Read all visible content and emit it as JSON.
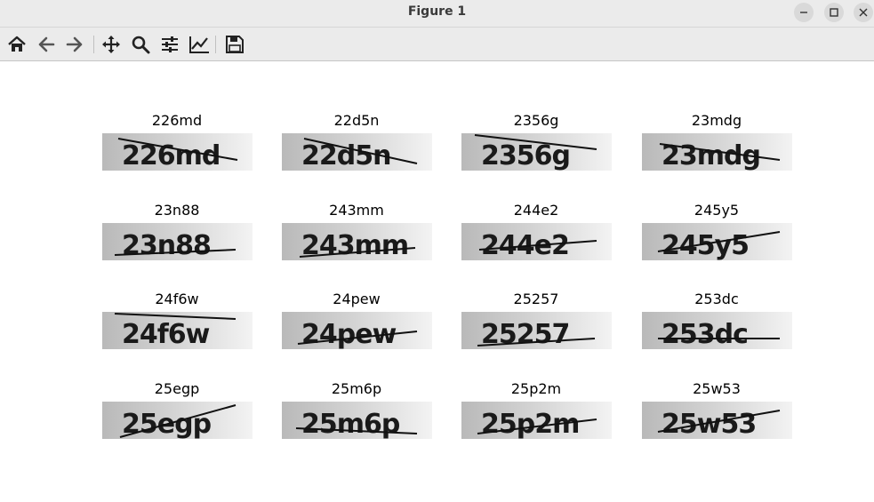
{
  "window": {
    "title": "Figure 1"
  },
  "window_controls": [
    "minimize-icon",
    "maximize-icon",
    "close-icon"
  ],
  "toolbar": {
    "tools": [
      {
        "name": "home-button",
        "icon": "home-icon"
      },
      {
        "name": "back-button",
        "icon": "arrow-left-icon"
      },
      {
        "name": "forward-button",
        "icon": "arrow-right-icon"
      },
      {
        "name": "pan-button",
        "icon": "move-icon"
      },
      {
        "name": "zoom-button",
        "icon": "magnifier-icon"
      },
      {
        "name": "subplots-button",
        "icon": "sliders-icon"
      },
      {
        "name": "axes-button",
        "icon": "line-chart-icon"
      },
      {
        "name": "save-button",
        "icon": "floppy-disk-icon"
      }
    ]
  },
  "captchas": [
    {
      "label": "226md",
      "text": "226md"
    },
    {
      "label": "22d5n",
      "text": "22d5n"
    },
    {
      "label": "2356g",
      "text": "2356g"
    },
    {
      "label": "23mdg",
      "text": "23mdg"
    },
    {
      "label": "23n88",
      "text": "23n88"
    },
    {
      "label": "243mm",
      "text": "243mm"
    },
    {
      "label": "244e2",
      "text": "244e2"
    },
    {
      "label": "245y5",
      "text": "245y5"
    },
    {
      "label": "24f6w",
      "text": "24f6w"
    },
    {
      "label": "24pew",
      "text": "24pew"
    },
    {
      "label": "25257",
      "text": "25257"
    },
    {
      "label": "253dc",
      "text": "253dc"
    },
    {
      "label": "25egp",
      "text": "25egp"
    },
    {
      "label": "25m6p",
      "text": "25m6p"
    },
    {
      "label": "25p2m",
      "text": "25p2m"
    },
    {
      "label": "25w53",
      "text": "25w53"
    }
  ]
}
